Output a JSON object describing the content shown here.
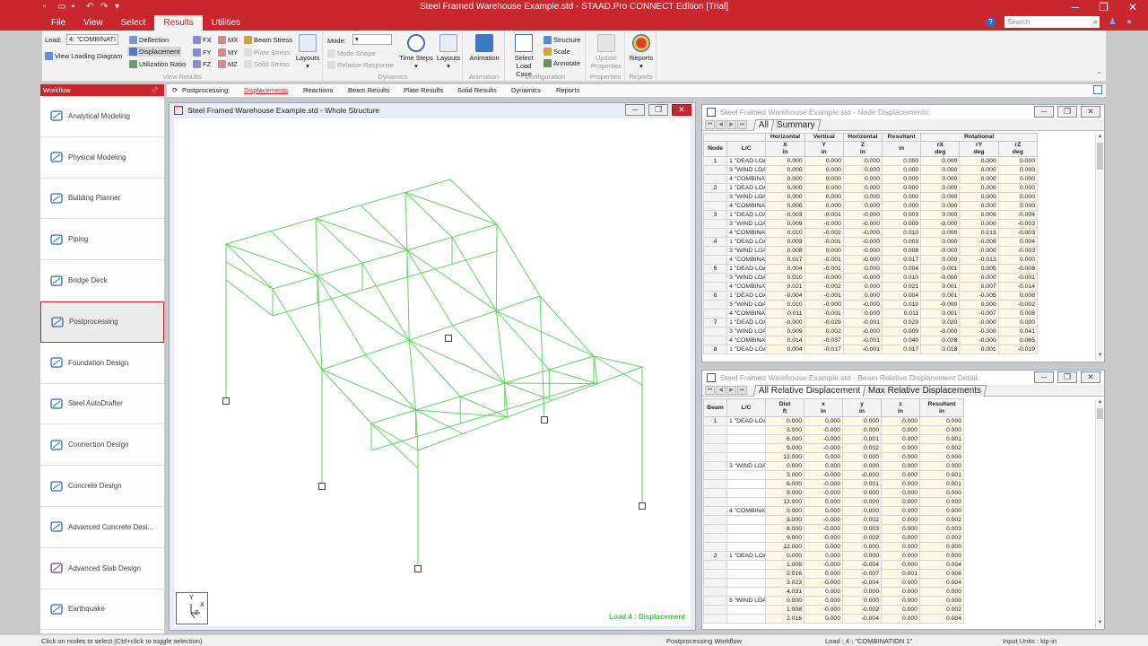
{
  "app": {
    "title": "Steel Framed Warehouse Example.std - STAAD.Pro CONNECT Edition [Trial]",
    "window_controls": [
      "─",
      "❐",
      "✕"
    ]
  },
  "menu": {
    "items": [
      "File",
      "View",
      "Select",
      "Results",
      "Utilities"
    ],
    "active": "Results",
    "search_placeholder": "Search"
  },
  "ribbon": {
    "load_label": "Load:",
    "load_value": "4: \"COMBINATI",
    "deflection": "Deflection",
    "displacement": "Displacement",
    "utilization": "Utilization Ratio",
    "view_loading": "View Loading Diagram",
    "fx": "FX",
    "fy": "FY",
    "fz": "FZ",
    "mx": "MX",
    "my": "MY",
    "mz": "MZ",
    "beam_stress": "Beam Stress",
    "plate_stress": "Plate Stress",
    "solid_stress": "Solid Stress",
    "layouts": "Layouts",
    "group_view_results": "View Results",
    "mode_label": "Mode:",
    "mode_shape": "Mode Shape",
    "relative_response": "Relative Response",
    "time_steps": "Time Steps",
    "layouts2": "Layouts",
    "group_dynamics": "Dynamics",
    "animation": "Animation",
    "group_animation": "Animation",
    "select_load_case_1": "Select",
    "select_load_case_2": "Load Case",
    "structure": "Structure",
    "scale": "Scale",
    "annotate": "Annotate",
    "group_configuration": "Configuration",
    "update_properties_1": "Update",
    "update_properties_2": "Properties",
    "group_properties": "Properties",
    "reports": "Reports",
    "group_reports": "Reports"
  },
  "workflow": {
    "header": "Workflow",
    "items": [
      {
        "label": "Analytical Modeling",
        "icon": "analytical-modeling-icon"
      },
      {
        "label": "Physical Modeling",
        "icon": "physical-modeling-icon"
      },
      {
        "label": "Building Planner",
        "icon": "building-planner-icon"
      },
      {
        "label": "Piping",
        "icon": "piping-icon"
      },
      {
        "label": "Bridge Deck",
        "icon": "bridge-deck-icon"
      },
      {
        "label": "Postprocessing",
        "icon": "postprocessing-icon"
      },
      {
        "label": "Foundation Design",
        "icon": "foundation-design-icon"
      },
      {
        "label": "Steel AutoDrafter",
        "icon": "steel-autodrafter-icon"
      },
      {
        "label": "Connection Design",
        "icon": "connection-design-icon"
      },
      {
        "label": "Concrete Design",
        "icon": "concrete-design-icon"
      },
      {
        "label": "Advanced Concrete Desi...",
        "icon": "advanced-concrete-design-icon"
      },
      {
        "label": "Advanced Slab Design",
        "icon": "advanced-slab-design-icon"
      },
      {
        "label": "Earthquake",
        "icon": "earthquake-icon"
      }
    ],
    "active_index": 5
  },
  "modetabs": {
    "prefix": "Postprocessing:",
    "items": [
      "Displacements",
      "Reactions",
      "Beam Results",
      "Plate Results",
      "Solid Results",
      "Dynamics",
      "Reports"
    ],
    "active": "Displacements"
  },
  "viewport": {
    "title": "Steel Framed Warehouse Example.std - Whole Structure",
    "load_label": "Load 4 : Displacement",
    "axes": {
      "y": "Y",
      "x": "X",
      "z": "Z"
    }
  },
  "node_table": {
    "title": "Steel Framed Warehouse Example.std - Node Displacements:",
    "tabs": [
      "All",
      "Summary"
    ],
    "group_headers": [
      "Horizontal",
      "Vertical",
      "Horizontal",
      "Resultant",
      "Rotational"
    ],
    "col_headers": [
      [
        "Node",
        ""
      ],
      [
        "L/C",
        ""
      ],
      [
        "X",
        "in"
      ],
      [
        "Y",
        "in"
      ],
      [
        "Z",
        "in"
      ],
      [
        "",
        "in"
      ],
      [
        "rX",
        "deg"
      ],
      [
        "rY",
        "deg"
      ],
      [
        "rZ",
        "deg"
      ]
    ],
    "rows": [
      [
        "1",
        "1 \"DEAD LOA",
        "0.000",
        "0.000",
        "0.000",
        "0.000",
        "0.000",
        "0.000",
        "0.000"
      ],
      [
        "",
        "3 \"WIND LOA",
        "0.000",
        "0.000",
        "0.000",
        "0.000",
        "0.000",
        "0.000",
        "0.000"
      ],
      [
        "",
        "4 \"COMBINAT",
        "0.000",
        "0.000",
        "0.000",
        "0.000",
        "0.000",
        "0.000",
        "0.000"
      ],
      [
        "2",
        "1 \"DEAD LOA",
        "0.000",
        "0.000",
        "0.000",
        "0.000",
        "0.000",
        "0.000",
        "0.000"
      ],
      [
        "",
        "3 \"WIND LOA",
        "0.000",
        "0.000",
        "0.000",
        "0.000",
        "0.000",
        "0.000",
        "0.000"
      ],
      [
        "",
        "4 \"COMBINAT",
        "0.000",
        "0.000",
        "0.000",
        "0.000",
        "0.000",
        "0.000",
        "0.000"
      ],
      [
        "3",
        "1 \"DEAD LOA",
        "-0.003",
        "-0.001",
        "-0.000",
        "0.003",
        "0.000",
        "0.009",
        "-0.004"
      ],
      [
        "",
        "3 \"WIND LOA",
        "0.009",
        "-0.000",
        "-0.000",
        "0.009",
        "-0.000",
        "0.000",
        "-0.003"
      ],
      [
        "",
        "4 \"COMBINAT",
        "0.010",
        "-0.002",
        "-0.000",
        "0.010",
        "0.000",
        "0.013",
        "-0.003"
      ],
      [
        "4",
        "1 \"DEAD LOA",
        "0.003",
        "-0.001",
        "-0.000",
        "0.003",
        "0.000",
        "-0.009",
        "0.004"
      ],
      [
        "",
        "3 \"WIND LOA",
        "0.008",
        "0.000",
        "-0.000",
        "0.008",
        "-0.000",
        "-0.000",
        "-0.003"
      ],
      [
        "",
        "4 \"COMBINAT",
        "0.017",
        "-0.001",
        "-0.000",
        "0.017",
        "0.000",
        "-0.013",
        "0.000"
      ],
      [
        "5",
        "1 \"DEAD LOA",
        "0.004",
        "-0.001",
        "0.000",
        "0.004",
        "0.001",
        "0.005",
        "-0.008"
      ],
      [
        "",
        "3 \"WIND LOA",
        "0.010",
        "-0.000",
        "-0.000",
        "0.010",
        "-0.000",
        "0.000",
        "-0.001"
      ],
      [
        "",
        "4 \"COMBINAT",
        "0.021",
        "-0.002",
        "0.000",
        "0.021",
        "0.001",
        "0.007",
        "-0.014"
      ],
      [
        "6",
        "1 \"DEAD LOA",
        "-0.004",
        "-0.001",
        "0.000",
        "0.004",
        "0.001",
        "-0.005",
        "0.008"
      ],
      [
        "",
        "3 \"WIND LOA",
        "0.010",
        "-0.000",
        "-0.000",
        "0.010",
        "-0.000",
        "0.000",
        "-0.002"
      ],
      [
        "",
        "4 \"COMBINAT",
        "0.011",
        "-0.001",
        "0.000",
        "0.011",
        "0.001",
        "-0.007",
        "0.008"
      ],
      [
        "7",
        "1 \"DEAD LOA",
        "-0.000",
        "-0.029",
        "-0.001",
        "0.029",
        "0.020",
        "-0.000",
        "0.000"
      ],
      [
        "",
        "3 \"WIND LOA",
        "0.009",
        "0.002",
        "-0.000",
        "0.009",
        "-0.000",
        "-0.000",
        "0.041"
      ],
      [
        "",
        "4 \"COMBINAT",
        "0.014",
        "-0.037",
        "-0.001",
        "0.040",
        "0.028",
        "-0.000",
        "0.065"
      ],
      [
        "8",
        "1 \"DEAD LOA",
        "0.004",
        "-0.017",
        "-0.001",
        "0.017",
        "0.018",
        "0.001",
        "-0.019"
      ]
    ]
  },
  "beam_table": {
    "title": "Steel Framed Warehouse Example.std - Beam Relative Displacement Detail:",
    "tabs": [
      "All Relative Displacement",
      "Max Relative Displacements"
    ],
    "col_headers": [
      [
        "Beam",
        ""
      ],
      [
        "L/C",
        ""
      ],
      [
        "Dist",
        "ft"
      ],
      [
        "x",
        "in"
      ],
      [
        "y",
        "in"
      ],
      [
        "z",
        "in"
      ],
      [
        "Resultant",
        "in"
      ]
    ],
    "rows": [
      [
        "1",
        "1 \"DEAD LOA",
        "0.000",
        "0.000",
        "0.000",
        "0.000",
        "0.000"
      ],
      [
        "",
        "",
        "3.000",
        "-0.000",
        "0.000",
        "0.000",
        "0.000"
      ],
      [
        "",
        "",
        "6.000",
        "-0.000",
        "0.001",
        "0.000",
        "0.001"
      ],
      [
        "",
        "",
        "9.000",
        "-0.000",
        "0.002",
        "0.000",
        "0.002"
      ],
      [
        "",
        "",
        "12.000",
        "0.000",
        "0.000",
        "0.000",
        "0.000"
      ],
      [
        "",
        "3 \"WIND LOA",
        "0.000",
        "0.000",
        "0.000",
        "0.000",
        "0.000"
      ],
      [
        "",
        "",
        "3.000",
        "-0.000",
        "-0.000",
        "0.000",
        "0.001"
      ],
      [
        "",
        "",
        "6.000",
        "-0.000",
        "0.001",
        "0.000",
        "0.001"
      ],
      [
        "",
        "",
        "9.000",
        "-0.000",
        "0.000",
        "0.000",
        "0.000"
      ],
      [
        "",
        "",
        "12.000",
        "0.000",
        "0.000",
        "0.000",
        "0.000"
      ],
      [
        "",
        "4 \"COMBINAT",
        "0.000",
        "0.000",
        "0.000",
        "0.000",
        "0.000"
      ],
      [
        "",
        "",
        "3.000",
        "-0.000",
        "0.002",
        "0.000",
        "0.002"
      ],
      [
        "",
        "",
        "6.000",
        "-0.000",
        "0.003",
        "0.000",
        "0.003"
      ],
      [
        "",
        "",
        "9.000",
        "-0.000",
        "0.002",
        "0.000",
        "0.002"
      ],
      [
        "",
        "",
        "12.000",
        "0.000",
        "0.000",
        "0.000",
        "0.000"
      ],
      [
        "2",
        "1 \"DEAD LOA",
        "0.000",
        "0.000",
        "0.000",
        "0.000",
        "0.000"
      ],
      [
        "",
        "",
        "1.008",
        "-0.000",
        "-0.004",
        "0.000",
        "0.004"
      ],
      [
        "",
        "",
        "2.016",
        "0.000",
        "-0.007",
        "0.001",
        "0.008"
      ],
      [
        "",
        "",
        "3.023",
        "-0.000",
        "-0.004",
        "0.000",
        "0.004"
      ],
      [
        "",
        "",
        "4.031",
        "0.000",
        "0.000",
        "0.000",
        "0.000"
      ],
      [
        "",
        "3 \"WIND LOA",
        "0.000",
        "0.000",
        "0.000",
        "0.000",
        "0.000"
      ],
      [
        "",
        "",
        "1.008",
        "-0.000",
        "-0.002",
        "0.000",
        "0.002"
      ],
      [
        "",
        "",
        "2.016",
        "0.000",
        "-0.004",
        "0.000",
        "0.004"
      ]
    ]
  },
  "status": {
    "hint": "Click on nodes to select (Ctrl+click to toggle selection)",
    "workflow": "Postprocessing Workflow",
    "load": "Load : 4 : \"COMBINATION 1\"",
    "units": "Input Units : kip-in"
  },
  "colors": {
    "brand": "#c8272d",
    "member": "#5cd65c",
    "support": "#444444"
  }
}
